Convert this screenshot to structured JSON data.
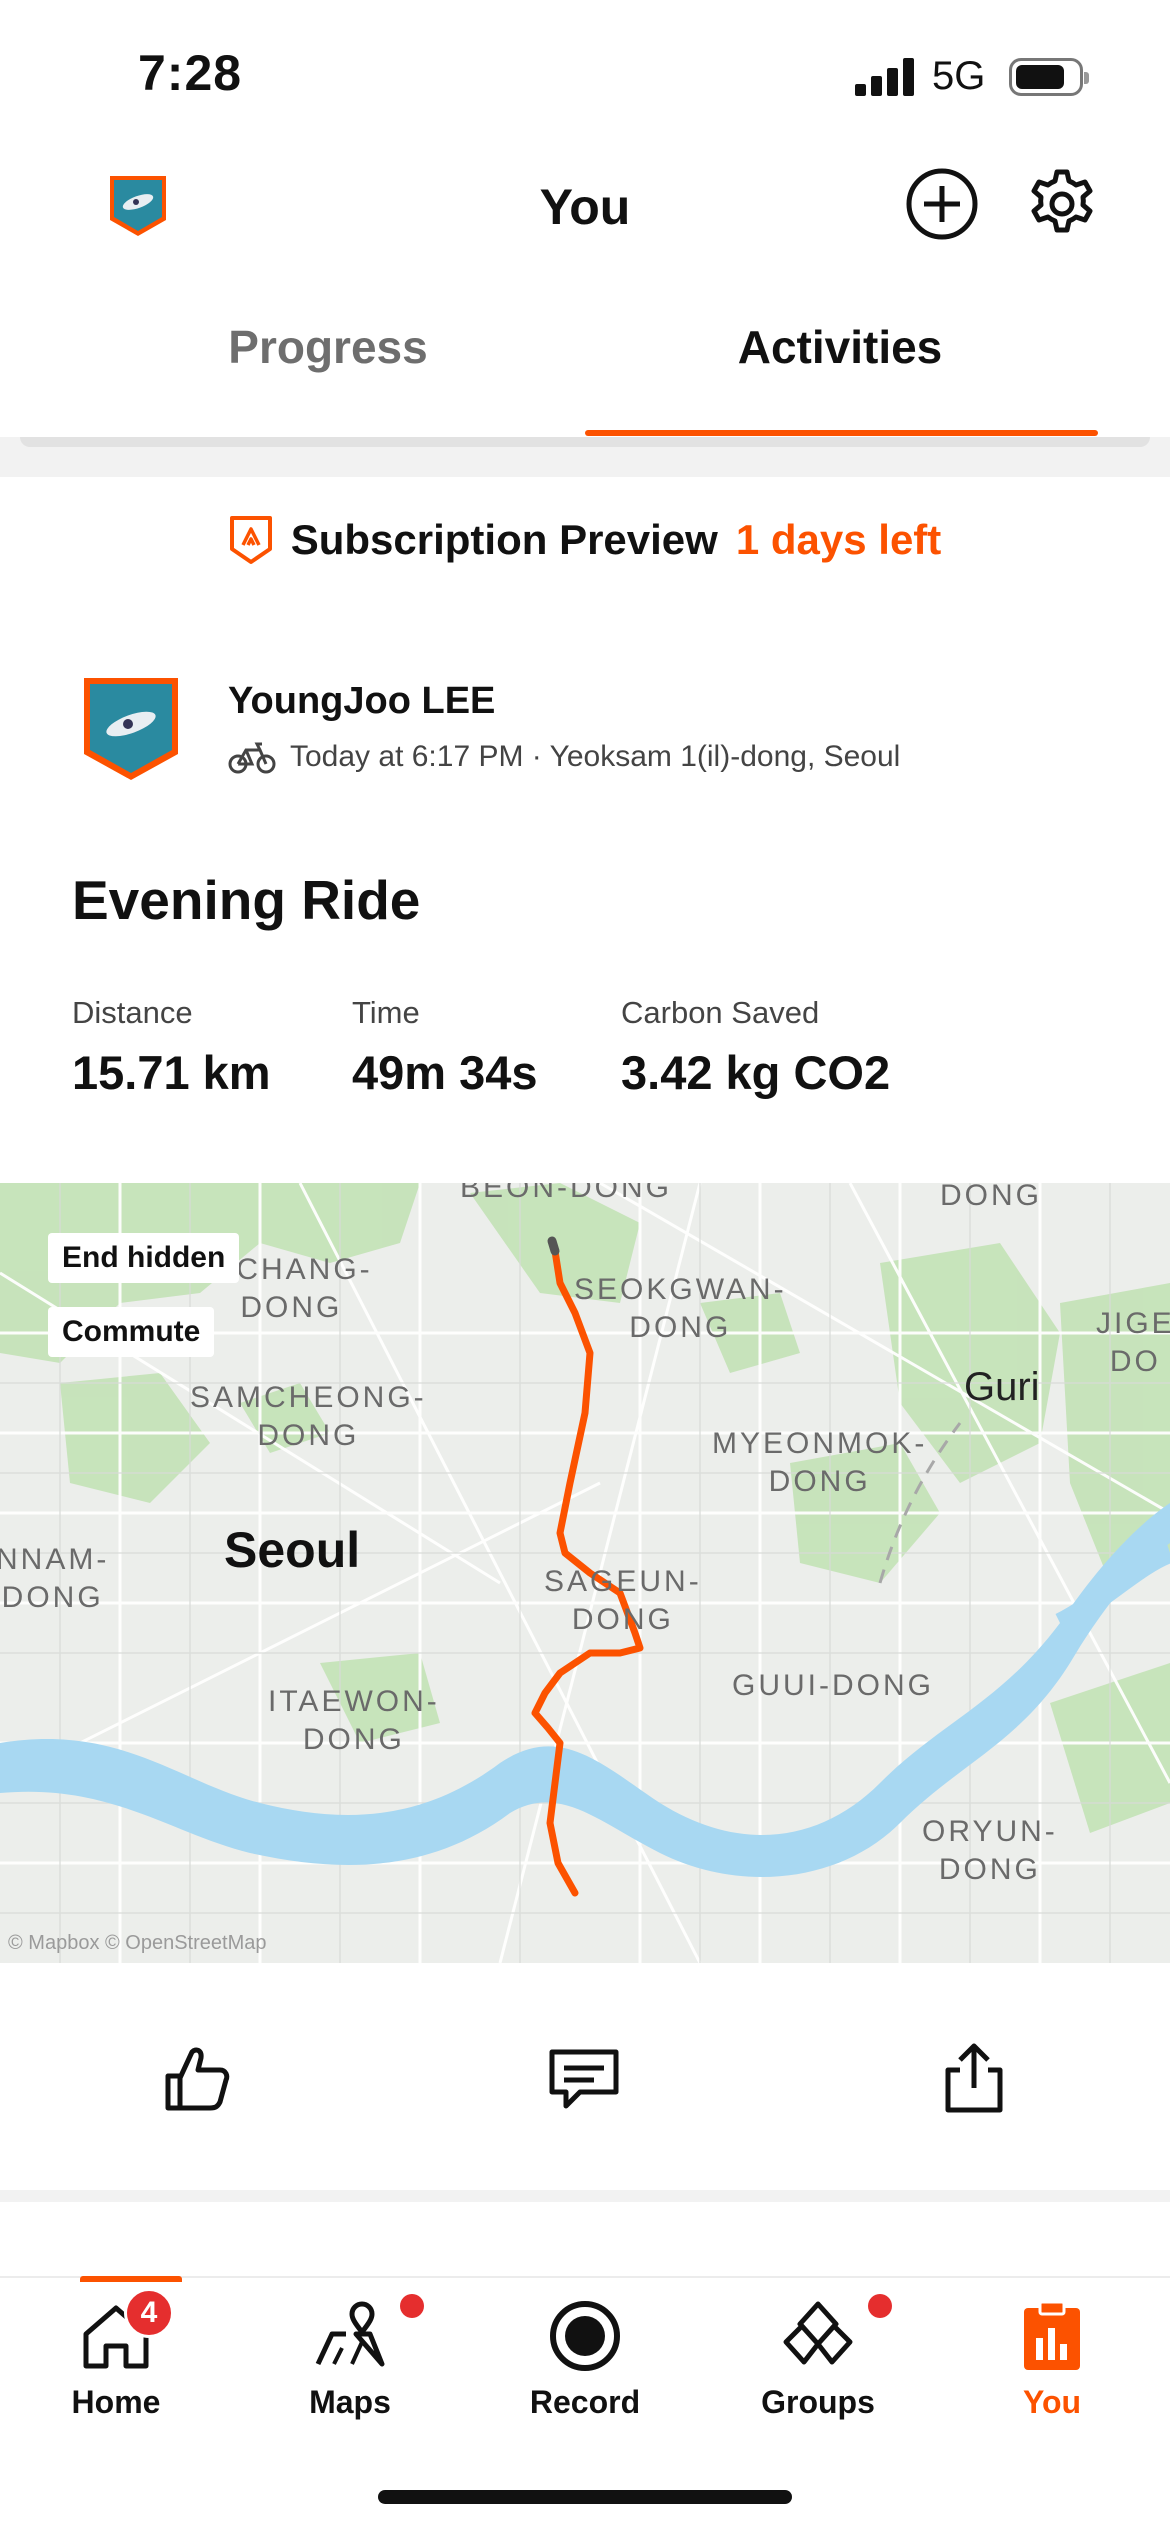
{
  "status_bar": {
    "time": "7:28",
    "network": "5G"
  },
  "header": {
    "title": "You",
    "icons": [
      "avatar",
      "add-circle-icon",
      "gear-icon"
    ]
  },
  "tabs": [
    {
      "label": "Progress",
      "active": false
    },
    {
      "label": "Activities",
      "active": true
    }
  ],
  "subscription": {
    "title": "Subscription Preview",
    "days_left": "1 days left"
  },
  "activity": {
    "athlete": "YoungJoo LEE",
    "meta": "Today at 6:17 PM · Yeoksam 1(il)-dong, Seoul",
    "sport_icon": "bike-icon",
    "title": "Evening Ride",
    "stats": [
      {
        "label": "Distance",
        "value": "15.71 km"
      },
      {
        "label": "Time",
        "value": "49m 34s"
      },
      {
        "label": "Carbon Saved",
        "value": "3.42 kg CO2"
      }
    ]
  },
  "map": {
    "chips": [
      "End hidden",
      "Commute"
    ],
    "labels": {
      "top_center": "BEON-DONG",
      "top_right": "DONG",
      "gchang": "GCHANG-\nDONG",
      "seokgwan": "SEOKGWAN-\nDONG",
      "jige": "JIGE\nDO",
      "samcheong": "SAMCHEONG-\nDONG",
      "myeonmok": "MYEONMOK-\nDONG",
      "nnam": "NNAM-\nDONG",
      "sageun": "SAGEUN-\nDONG",
      "itaewon": "ITAEWON-\nDONG",
      "guui": "GUUI-DONG",
      "oryun": "ORYUN-\nDONG"
    },
    "cities": {
      "seoul": "Seoul",
      "guri": "Guri"
    },
    "attribution": "© Mapbox © OpenStreetMap",
    "route_color": "#fc5200",
    "water_color": "#a8d8f2",
    "green_color": "#bfe0b3"
  },
  "actions": [
    "thumbs-up-icon",
    "comment-icon",
    "share-icon"
  ],
  "bottom_nav": [
    {
      "label": "Home",
      "badge": "4",
      "active": false
    },
    {
      "label": "Maps",
      "dot": true,
      "active": false
    },
    {
      "label": "Record",
      "active": false
    },
    {
      "label": "Groups",
      "dot": true,
      "active": false
    },
    {
      "label": "You",
      "active": true
    }
  ],
  "accent_color": "#fc5200"
}
